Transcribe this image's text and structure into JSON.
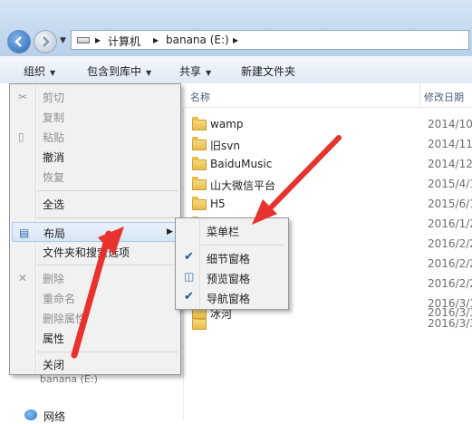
{
  "address": {
    "breadcrumbs": [
      "计算机",
      "banana (E:)"
    ]
  },
  "toolbar": {
    "organize": "组织",
    "include_library": "包含到库中",
    "share": "共享",
    "new_folder": "新建文件夹"
  },
  "columns": {
    "name": "名称",
    "modified": "修改日期"
  },
  "files": [
    {
      "name": "wamp",
      "date": "2014/10,"
    },
    {
      "name": "旧svn",
      "date": "2014/11,"
    },
    {
      "name": "BaiduMusic",
      "date": "2014/12,"
    },
    {
      "name": "山大微信平台",
      "date": "2015/4/1"
    },
    {
      "name": "H5",
      "date": "2015/6/1"
    },
    {
      "name": "",
      "date": "2016/1/2"
    },
    {
      "name": "",
      "date": "2016/2/2"
    },
    {
      "name": "",
      "date": "2016/2/2"
    },
    {
      "name": "",
      "date": "2016/2/2"
    },
    {
      "name": "",
      "date": "2016/3/1"
    },
    {
      "name": "",
      "date": "2016/3/3"
    },
    {
      "name": "冰河",
      "date": "2016/3/3"
    }
  ],
  "organize_menu": {
    "cut": "剪切",
    "copy": "复制",
    "paste": "粘贴",
    "undo": "撤消",
    "redo": "恢复",
    "select_all": "全选",
    "layout": "布局",
    "folder_options": "文件夹和搜索选项",
    "delete": "删除",
    "rename": "重命名",
    "remove_props": "删除属性",
    "properties": "属性",
    "close": "关闭"
  },
  "layout_submenu": {
    "menubar": "菜单栏",
    "details_pane": "细节窗格",
    "preview_pane": "预览窗格",
    "nav_pane": "导航窗格"
  },
  "nav": {
    "drive": "banana (E:)",
    "network": "网络"
  },
  "colors": {
    "arrow": "#e8322d",
    "highlight": "#d7e6f6"
  }
}
